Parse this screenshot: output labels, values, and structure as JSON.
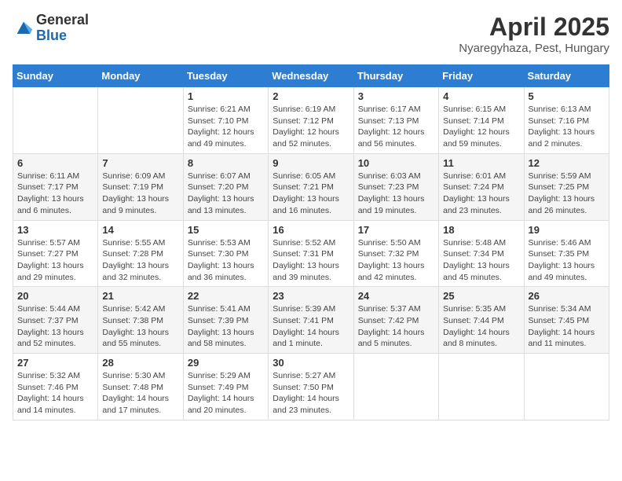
{
  "header": {
    "logo_general": "General",
    "logo_blue": "Blue",
    "title": "April 2025",
    "subtitle": "Nyaregyhaza, Pest, Hungary"
  },
  "calendar": {
    "days_of_week": [
      "Sunday",
      "Monday",
      "Tuesday",
      "Wednesday",
      "Thursday",
      "Friday",
      "Saturday"
    ],
    "weeks": [
      [
        {
          "day": "",
          "detail": ""
        },
        {
          "day": "",
          "detail": ""
        },
        {
          "day": "1",
          "detail": "Sunrise: 6:21 AM\nSunset: 7:10 PM\nDaylight: 12 hours and 49 minutes."
        },
        {
          "day": "2",
          "detail": "Sunrise: 6:19 AM\nSunset: 7:12 PM\nDaylight: 12 hours and 52 minutes."
        },
        {
          "day": "3",
          "detail": "Sunrise: 6:17 AM\nSunset: 7:13 PM\nDaylight: 12 hours and 56 minutes."
        },
        {
          "day": "4",
          "detail": "Sunrise: 6:15 AM\nSunset: 7:14 PM\nDaylight: 12 hours and 59 minutes."
        },
        {
          "day": "5",
          "detail": "Sunrise: 6:13 AM\nSunset: 7:16 PM\nDaylight: 13 hours and 2 minutes."
        }
      ],
      [
        {
          "day": "6",
          "detail": "Sunrise: 6:11 AM\nSunset: 7:17 PM\nDaylight: 13 hours and 6 minutes."
        },
        {
          "day": "7",
          "detail": "Sunrise: 6:09 AM\nSunset: 7:19 PM\nDaylight: 13 hours and 9 minutes."
        },
        {
          "day": "8",
          "detail": "Sunrise: 6:07 AM\nSunset: 7:20 PM\nDaylight: 13 hours and 13 minutes."
        },
        {
          "day": "9",
          "detail": "Sunrise: 6:05 AM\nSunset: 7:21 PM\nDaylight: 13 hours and 16 minutes."
        },
        {
          "day": "10",
          "detail": "Sunrise: 6:03 AM\nSunset: 7:23 PM\nDaylight: 13 hours and 19 minutes."
        },
        {
          "day": "11",
          "detail": "Sunrise: 6:01 AM\nSunset: 7:24 PM\nDaylight: 13 hours and 23 minutes."
        },
        {
          "day": "12",
          "detail": "Sunrise: 5:59 AM\nSunset: 7:25 PM\nDaylight: 13 hours and 26 minutes."
        }
      ],
      [
        {
          "day": "13",
          "detail": "Sunrise: 5:57 AM\nSunset: 7:27 PM\nDaylight: 13 hours and 29 minutes."
        },
        {
          "day": "14",
          "detail": "Sunrise: 5:55 AM\nSunset: 7:28 PM\nDaylight: 13 hours and 32 minutes."
        },
        {
          "day": "15",
          "detail": "Sunrise: 5:53 AM\nSunset: 7:30 PM\nDaylight: 13 hours and 36 minutes."
        },
        {
          "day": "16",
          "detail": "Sunrise: 5:52 AM\nSunset: 7:31 PM\nDaylight: 13 hours and 39 minutes."
        },
        {
          "day": "17",
          "detail": "Sunrise: 5:50 AM\nSunset: 7:32 PM\nDaylight: 13 hours and 42 minutes."
        },
        {
          "day": "18",
          "detail": "Sunrise: 5:48 AM\nSunset: 7:34 PM\nDaylight: 13 hours and 45 minutes."
        },
        {
          "day": "19",
          "detail": "Sunrise: 5:46 AM\nSunset: 7:35 PM\nDaylight: 13 hours and 49 minutes."
        }
      ],
      [
        {
          "day": "20",
          "detail": "Sunrise: 5:44 AM\nSunset: 7:37 PM\nDaylight: 13 hours and 52 minutes."
        },
        {
          "day": "21",
          "detail": "Sunrise: 5:42 AM\nSunset: 7:38 PM\nDaylight: 13 hours and 55 minutes."
        },
        {
          "day": "22",
          "detail": "Sunrise: 5:41 AM\nSunset: 7:39 PM\nDaylight: 13 hours and 58 minutes."
        },
        {
          "day": "23",
          "detail": "Sunrise: 5:39 AM\nSunset: 7:41 PM\nDaylight: 14 hours and 1 minute."
        },
        {
          "day": "24",
          "detail": "Sunrise: 5:37 AM\nSunset: 7:42 PM\nDaylight: 14 hours and 5 minutes."
        },
        {
          "day": "25",
          "detail": "Sunrise: 5:35 AM\nSunset: 7:44 PM\nDaylight: 14 hours and 8 minutes."
        },
        {
          "day": "26",
          "detail": "Sunrise: 5:34 AM\nSunset: 7:45 PM\nDaylight: 14 hours and 11 minutes."
        }
      ],
      [
        {
          "day": "27",
          "detail": "Sunrise: 5:32 AM\nSunset: 7:46 PM\nDaylight: 14 hours and 14 minutes."
        },
        {
          "day": "28",
          "detail": "Sunrise: 5:30 AM\nSunset: 7:48 PM\nDaylight: 14 hours and 17 minutes."
        },
        {
          "day": "29",
          "detail": "Sunrise: 5:29 AM\nSunset: 7:49 PM\nDaylight: 14 hours and 20 minutes."
        },
        {
          "day": "30",
          "detail": "Sunrise: 5:27 AM\nSunset: 7:50 PM\nDaylight: 14 hours and 23 minutes."
        },
        {
          "day": "",
          "detail": ""
        },
        {
          "day": "",
          "detail": ""
        },
        {
          "day": "",
          "detail": ""
        }
      ]
    ]
  }
}
